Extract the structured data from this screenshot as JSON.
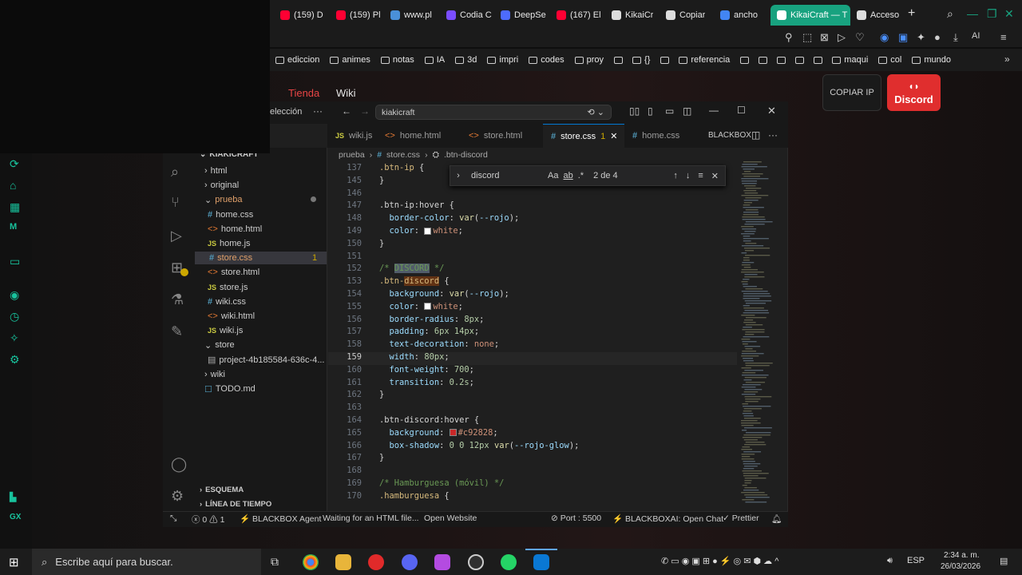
{
  "browser": {
    "tabs": [
      {
        "label": "(159) D",
        "icon": "youtube-icon",
        "color": "#ff0033"
      },
      {
        "label": "(159) Pl",
        "icon": "youtube-icon",
        "color": "#ff0033"
      },
      {
        "label": "www.pl",
        "icon": "globe-icon",
        "color": "#4a90d9"
      },
      {
        "label": "Codia C",
        "icon": "codia-icon",
        "color": "#7a4dff"
      },
      {
        "label": "DeepSe",
        "icon": "deepseek-icon",
        "color": "#4d6bfe"
      },
      {
        "label": "(167) El",
        "icon": "youtube-icon",
        "color": "#ff0033"
      },
      {
        "label": "KikaiCr",
        "icon": "page-icon",
        "color": "#dddddd"
      },
      {
        "label": "Copiar",
        "icon": "copy-icon",
        "color": "#dddddd"
      },
      {
        "label": "ancho",
        "icon": "google-icon",
        "color": "#4285f4"
      },
      {
        "label": "KikaiCraft — T",
        "icon": "page-icon",
        "color": "#ffffff",
        "active": true
      },
      {
        "label": "Acceso",
        "icon": "grid-icon",
        "color": "#dddddd"
      }
    ],
    "bookmarks": [
      "ediccion",
      "animes",
      "notas",
      "IA",
      "3d",
      "impri",
      "codes",
      "proy",
      "",
      "{}",
      "",
      "referencia",
      "",
      "",
      "",
      "",
      "",
      "maqui",
      "col",
      "mundo"
    ],
    "ai_label": "AI"
  },
  "page": {
    "nav_store": "Tienda",
    "nav_wiki": "Wiki",
    "copy_ip": "COPIAR IP",
    "discord": "Discord"
  },
  "vscode": {
    "title_fragment": "elección",
    "search_text": "kiakicraft",
    "tabs": [
      {
        "label": "wiki.js",
        "kind": "js"
      },
      {
        "label": "home.html",
        "kind": "html"
      },
      {
        "label": "store.html",
        "kind": "html"
      },
      {
        "label": "store.css",
        "kind": "css",
        "active": true,
        "badge": "1"
      },
      {
        "label": "home.css",
        "kind": "css"
      }
    ],
    "blackbox_label": "BLACKBOX",
    "breadcrumb": [
      "prueba",
      "store.css",
      ".btn-discord"
    ],
    "explorer": {
      "root": "KIAKICRAFT",
      "items": [
        {
          "label": "html",
          "type": "folder",
          "depth": 1
        },
        {
          "label": "original",
          "type": "folder",
          "depth": 1
        },
        {
          "label": "prueba",
          "type": "folder-open",
          "depth": 1
        },
        {
          "label": "home.css",
          "type": "css",
          "depth": 2
        },
        {
          "label": "home.html",
          "type": "html",
          "depth": 2
        },
        {
          "label": "home.js",
          "type": "js",
          "depth": 2
        },
        {
          "label": "store.css",
          "type": "css",
          "depth": 2,
          "badge": "1",
          "selected": true
        },
        {
          "label": "store.html",
          "type": "html",
          "depth": 2
        },
        {
          "label": "store.js",
          "type": "js",
          "depth": 2
        },
        {
          "label": "wiki.css",
          "type": "css",
          "depth": 2
        },
        {
          "label": "wiki.html",
          "type": "html",
          "depth": 2
        },
        {
          "label": "wiki.js",
          "type": "js",
          "depth": 2
        },
        {
          "label": "store",
          "type": "folder-open",
          "depth": 1
        },
        {
          "label": "project-4b185584-636c-4...",
          "type": "file",
          "depth": 2
        },
        {
          "label": "wiki",
          "type": "folder",
          "depth": 1
        },
        {
          "label": "TODO.md",
          "type": "md",
          "depth": 1
        }
      ],
      "outline": "ESQUEMA",
      "timeline": "LÍNEA DE TIEMPO"
    },
    "find": {
      "query": "discord",
      "case_label": "Aa",
      "word_label": "ab",
      "regex_label": ".*",
      "count": "2 de 4"
    },
    "code": [
      {
        "n": "137",
        "t": ".btn-ip {"
      },
      {
        "n": "145",
        "t": "}"
      },
      {
        "n": "146",
        "t": ""
      },
      {
        "n": "147",
        "t": ".btn-ip:hover {"
      },
      {
        "n": "148",
        "t": "  border-color: var(--rojo);"
      },
      {
        "n": "149",
        "t": "  color: white;"
      },
      {
        "n": "150",
        "t": "}"
      },
      {
        "n": "151",
        "t": ""
      },
      {
        "n": "152",
        "t": "/* DISCORD */"
      },
      {
        "n": "153",
        "t": ".btn-discord {"
      },
      {
        "n": "154",
        "t": "  background: var(--rojo);"
      },
      {
        "n": "155",
        "t": "  color: white;"
      },
      {
        "n": "156",
        "t": "  border-radius: 8px;"
      },
      {
        "n": "157",
        "t": "  padding: 6px 14px;"
      },
      {
        "n": "158",
        "t": "  text-decoration: none;"
      },
      {
        "n": "159",
        "t": "  width: 80px;"
      },
      {
        "n": "160",
        "t": "  font-weight: 700;"
      },
      {
        "n": "161",
        "t": "  transition: 0.2s;"
      },
      {
        "n": "162",
        "t": "}"
      },
      {
        "n": "163",
        "t": ""
      },
      {
        "n": "164",
        "t": ".btn-discord:hover {"
      },
      {
        "n": "165",
        "t": "  background: #c92828;"
      },
      {
        "n": "166",
        "t": "  box-shadow: 0 0 12px var(--rojo-glow);"
      },
      {
        "n": "167",
        "t": "}"
      },
      {
        "n": "168",
        "t": ""
      },
      {
        "n": "169",
        "t": "/* Hamburguesa (móvil) */"
      },
      {
        "n": "170",
        "t": ".hamburguesa {"
      }
    ],
    "current_line": "159",
    "status": {
      "errors": "0",
      "warnings": "1",
      "agent": "BLACKBOX Agent",
      "waiting": "Waiting for an HTML file...",
      "open_website": "Open Website",
      "port": "Port : 5500",
      "blackbox_ai": "BLACKBOXAI: Open Chat",
      "prettier": "Prettier"
    }
  },
  "taskbar": {
    "search_placeholder": "Escribe aquí para buscar.",
    "lang": "ESP",
    "time": "2:34 a. m.",
    "date": "26/03/2026"
  }
}
